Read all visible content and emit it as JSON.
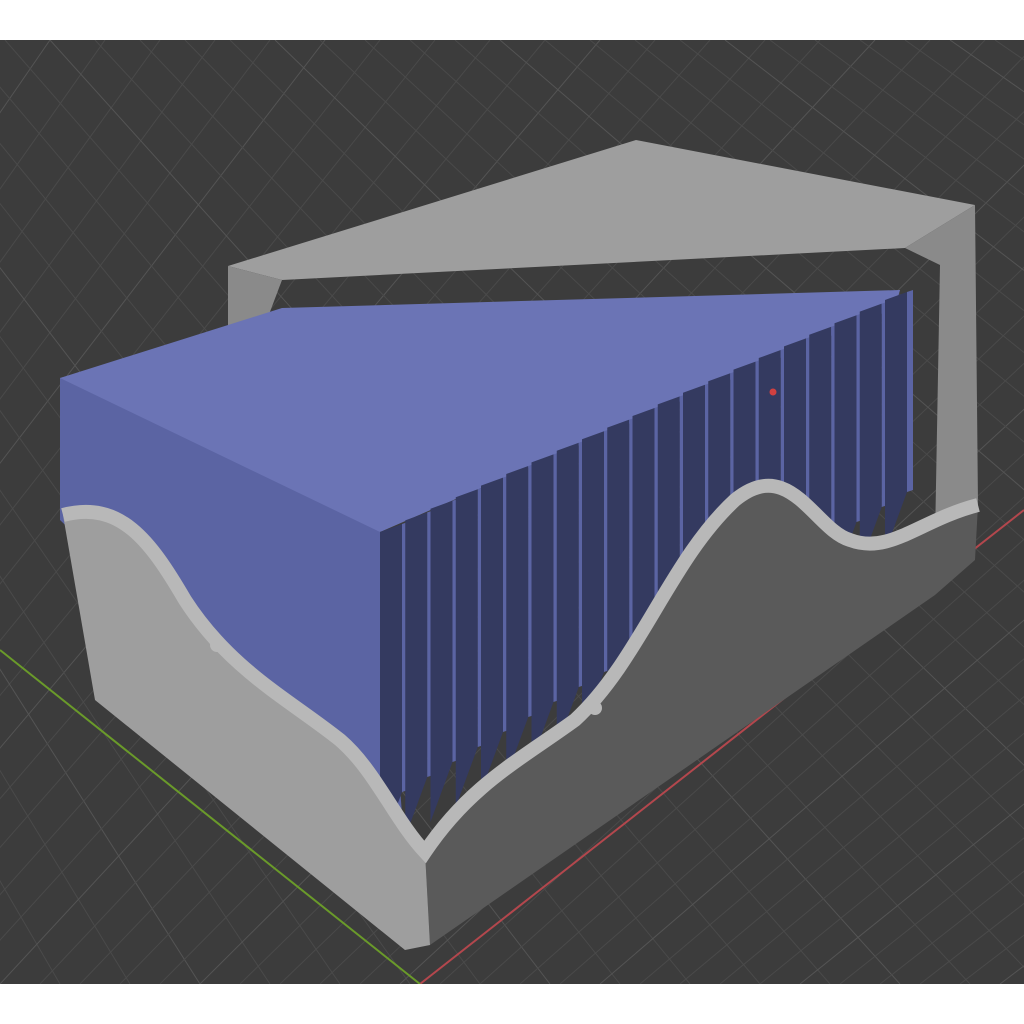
{
  "viewport": {
    "background_color": "#3c3c3c",
    "grid_minor_color": "#4a4a4a",
    "grid_major_color": "#545454",
    "axis_x_color": "#b3474d",
    "axis_y_color": "#6a9a2a"
  },
  "model": {
    "housing_light_color": "#9e9e9e",
    "housing_mid_color": "#8a8a8a",
    "housing_dark_color": "#5a5a5a",
    "housing_edge_color": "#b8b8b8",
    "fin_face_color": "#5b64a3",
    "fin_side_color": "#343a60",
    "fin_top_color": "#6b74b5",
    "fin_count": 21,
    "origin_marker_color": "#d04040"
  }
}
